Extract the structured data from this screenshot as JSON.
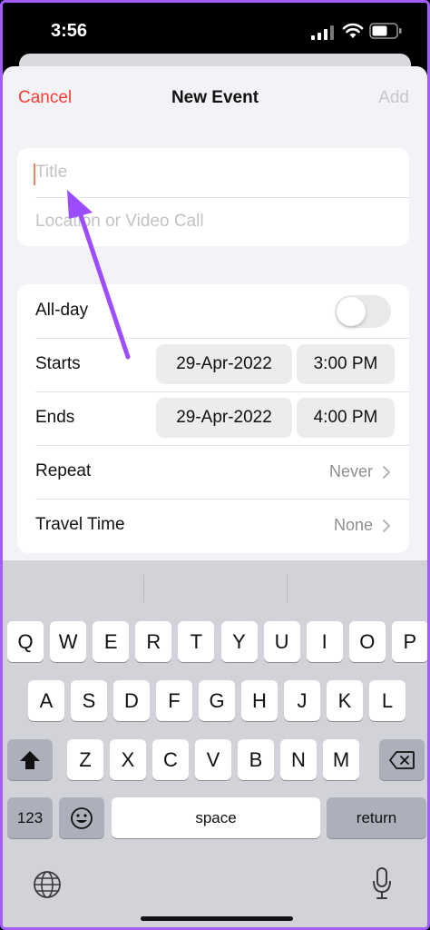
{
  "status_bar": {
    "time": "3:56"
  },
  "nav": {
    "cancel": "Cancel",
    "title": "New Event",
    "add": "Add"
  },
  "fields": {
    "title_placeholder": "Title",
    "location_placeholder": "Location or Video Call"
  },
  "rows": {
    "allday": {
      "label": "All-day",
      "on": false
    },
    "starts": {
      "label": "Starts",
      "date": "29-Apr-2022",
      "time": "3:00 PM"
    },
    "ends": {
      "label": "Ends",
      "date": "29-Apr-2022",
      "time": "4:00 PM"
    },
    "repeat": {
      "label": "Repeat",
      "value": "Never"
    },
    "travel": {
      "label": "Travel Time",
      "value": "None"
    }
  },
  "keyboard": {
    "row1": [
      "Q",
      "W",
      "E",
      "R",
      "T",
      "Y",
      "U",
      "I",
      "O",
      "P"
    ],
    "row2": [
      "A",
      "S",
      "D",
      "F",
      "G",
      "H",
      "J",
      "K",
      "L"
    ],
    "row3": [
      "Z",
      "X",
      "C",
      "V",
      "B",
      "N",
      "M"
    ],
    "numbers": "123",
    "space": "space",
    "return": "return"
  },
  "colors": {
    "accent": "#ff3b30",
    "annotation": "#9b4dff"
  },
  "icons": [
    "signal-icon",
    "wifi-icon",
    "battery-icon",
    "chevron-right-icon",
    "shift-icon",
    "delete-icon",
    "emoji-icon",
    "globe-icon",
    "mic-icon",
    "annotation-arrow"
  ]
}
